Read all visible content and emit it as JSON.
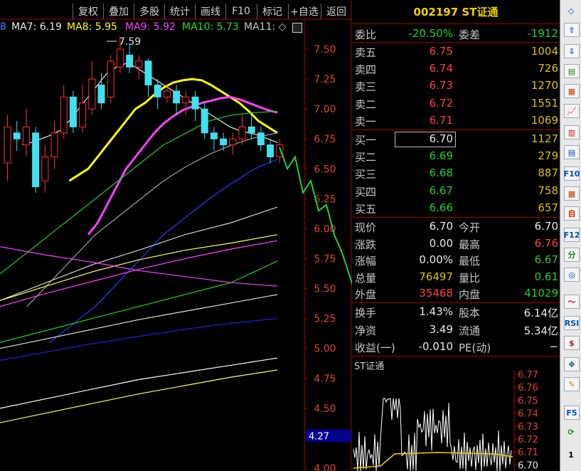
{
  "toolbar": {
    "items": [
      "复权",
      "叠加",
      "多股",
      "统计",
      "画线",
      "F10",
      "标记",
      "+自选",
      "返回"
    ]
  },
  "ma_legend": [
    {
      "label": "8",
      "color": "#4080ff"
    },
    {
      "label": "MA7: 6.19",
      "color": "#e8e8e8"
    },
    {
      "label": "MA8: 5.95",
      "color": "#ffff00"
    },
    {
      "label": "MA9: 5.92",
      "color": "#ff40ff"
    },
    {
      "label": "MA10: 5.73",
      "color": "#20e020"
    },
    {
      "label": "MA11: ◇",
      "color": "#c8c8c8"
    }
  ],
  "chart_data": {
    "type": "candlestick",
    "title": "",
    "y_ticks": [
      "7.50",
      "7.25",
      "7.00",
      "6.75",
      "6.50",
      "6.25",
      "6.00",
      "5.75",
      "5.50",
      "5.25",
      "5.00",
      "4.75",
      "4.50",
      "4.25",
      "4.00"
    ],
    "ylim": [
      4.0,
      7.59
    ],
    "high_annotation": "7.59",
    "cursor_price": "4.27",
    "candles": [
      {
        "o": 6.55,
        "c": 6.85,
        "h": 6.95,
        "l": 6.4
      },
      {
        "o": 6.8,
        "c": 6.75,
        "h": 6.9,
        "l": 6.65
      },
      {
        "o": 6.7,
        "c": 6.85,
        "h": 7.0,
        "l": 6.6
      },
      {
        "o": 6.8,
        "c": 6.35,
        "h": 6.85,
        "l": 6.3
      },
      {
        "o": 6.4,
        "c": 6.6,
        "h": 6.7,
        "l": 6.3
      },
      {
        "o": 6.6,
        "c": 6.8,
        "h": 6.9,
        "l": 6.5
      },
      {
        "o": 6.8,
        "c": 7.1,
        "h": 7.2,
        "l": 6.75
      },
      {
        "o": 7.1,
        "c": 6.85,
        "h": 7.15,
        "l": 6.8
      },
      {
        "o": 6.85,
        "c": 7.05,
        "h": 7.2,
        "l": 6.8
      },
      {
        "o": 7.0,
        "c": 7.25,
        "h": 7.4,
        "l": 6.95
      },
      {
        "o": 7.2,
        "c": 7.05,
        "h": 7.3,
        "l": 7.0
      },
      {
        "o": 7.1,
        "c": 7.4,
        "h": 7.45,
        "l": 7.05
      },
      {
        "o": 7.35,
        "c": 7.5,
        "h": 7.59,
        "l": 7.3
      },
      {
        "o": 7.45,
        "c": 7.35,
        "h": 7.55,
        "l": 7.3
      },
      {
        "o": 7.35,
        "c": 7.4,
        "h": 7.45,
        "l": 7.25
      },
      {
        "o": 7.4,
        "c": 7.2,
        "h": 7.42,
        "l": 7.1
      },
      {
        "o": 7.2,
        "c": 7.1,
        "h": 7.25,
        "l": 7.0
      },
      {
        "o": 7.1,
        "c": 7.15,
        "h": 7.2,
        "l": 7.05
      },
      {
        "o": 7.15,
        "c": 7.05,
        "h": 7.2,
        "l": 6.95
      },
      {
        "o": 7.05,
        "c": 7.1,
        "h": 7.15,
        "l": 6.95
      },
      {
        "o": 7.1,
        "c": 7.0,
        "h": 7.15,
        "l": 6.9
      },
      {
        "o": 7.0,
        "c": 6.8,
        "h": 7.05,
        "l": 6.75
      },
      {
        "o": 6.8,
        "c": 6.75,
        "h": 6.85,
        "l": 6.65
      },
      {
        "o": 6.75,
        "c": 6.7,
        "h": 6.8,
        "l": 6.65
      },
      {
        "o": 6.7,
        "c": 6.75,
        "h": 6.8,
        "l": 6.62
      },
      {
        "o": 6.75,
        "c": 6.85,
        "h": 6.95,
        "l": 6.7
      },
      {
        "o": 6.85,
        "c": 6.8,
        "h": 6.95,
        "l": 6.75
      },
      {
        "o": 6.8,
        "c": 6.7,
        "h": 6.85,
        "l": 6.65
      },
      {
        "o": 6.7,
        "c": 6.6,
        "h": 6.75,
        "l": 6.55
      },
      {
        "o": 6.6,
        "c": 6.7,
        "h": 6.75,
        "l": 6.55
      }
    ],
    "ma_lines": [
      {
        "color": "#e8e8e8",
        "values": [
          6.7,
          6.72,
          6.75,
          6.78,
          6.82,
          6.9,
          7.0,
          7.1,
          7.2,
          7.3,
          7.35,
          7.38,
          7.35,
          7.3,
          7.25,
          7.2,
          7.15,
          7.1,
          7.05,
          7.0,
          6.95,
          6.9,
          6.85,
          6.82,
          6.8,
          6.78,
          6.75,
          6.72
        ]
      },
      {
        "color": "#ffff00",
        "values": [
          6.4,
          6.45,
          6.5,
          6.6,
          6.7,
          6.8,
          6.9,
          7.0,
          7.05,
          7.12,
          7.18,
          7.22,
          7.24,
          7.25,
          7.24,
          7.2,
          7.15,
          7.1,
          7.05,
          6.98,
          6.9,
          6.85,
          6.8
        ]
      },
      {
        "color": "#ff40ff",
        "values": [
          5.95,
          6.05,
          6.2,
          6.35,
          6.5,
          6.6,
          6.7,
          6.8,
          6.88,
          6.94,
          6.99,
          7.02,
          7.05,
          7.07,
          7.09,
          7.1,
          7.08,
          7.05,
          7.02,
          6.99,
          6.97
        ]
      },
      {
        "color": "#20d020",
        "values": [
          5.2,
          5.35,
          5.5,
          5.65,
          5.8,
          5.95,
          6.1,
          6.25,
          6.4,
          6.55,
          6.7,
          6.8,
          6.9,
          6.95,
          6.97,
          6.98
        ]
      },
      {
        "color": "#a0a0a0",
        "values": [
          5.35,
          5.55,
          5.75,
          5.95,
          6.1,
          6.25,
          6.4,
          6.52,
          6.62,
          6.7,
          6.76,
          6.8
        ]
      },
      {
        "color": "#2040ff",
        "values": [
          5.05,
          5.2,
          5.35,
          5.55,
          5.75,
          5.95,
          6.1,
          6.25,
          6.38,
          6.5,
          6.58
        ]
      },
      {
        "color": "#d0d0d0",
        "values": [
          5.25,
          5.4,
          5.55,
          5.7,
          5.82,
          5.95,
          6.05,
          6.18
        ]
      },
      {
        "color": "#ffff40",
        "values": [
          5.4,
          5.52,
          5.64,
          5.74,
          5.82,
          5.88,
          5.95
        ]
      },
      {
        "color": "#ff40ff",
        "values": [
          5.35,
          5.46,
          5.56,
          5.66,
          5.75,
          5.83,
          5.9
        ]
      },
      {
        "color": "#20d020",
        "values": [
          5.05,
          5.15,
          5.25,
          5.35,
          5.45,
          5.55,
          5.73
        ]
      },
      {
        "color": "#ff40ff",
        "values": [
          5.85,
          5.78,
          5.72,
          5.65,
          5.6,
          5.55,
          5.52
        ]
      },
      {
        "color": "#e0e0e0",
        "values": [
          5.0,
          5.08,
          5.16,
          5.24,
          5.31,
          5.38,
          5.45
        ]
      },
      {
        "color": "#2020e0",
        "values": [
          4.9,
          4.97,
          5.04,
          5.1,
          5.16,
          5.21,
          5.25
        ]
      },
      {
        "color": "#ffffff",
        "values": [
          4.5,
          4.58,
          4.66,
          4.74,
          4.8,
          4.86,
          4.92
        ]
      },
      {
        "color": "#ffff40",
        "values": [
          4.38,
          4.46,
          4.54,
          4.62,
          4.69,
          4.76,
          4.82
        ]
      }
    ],
    "projection": [
      6.68,
      6.5,
      6.6,
      6.3,
      6.4,
      6.15,
      6.2,
      5.95,
      5.8,
      5.6,
      5.4
    ]
  },
  "quote": {
    "code": "002197",
    "name": "ST证通",
    "weibi_label": "委比",
    "weibi": "-20.50%",
    "weicha_label": "委差",
    "weicha": "-1912",
    "asks": [
      {
        "label": "卖五",
        "price": "6.75",
        "vol": "1004"
      },
      {
        "label": "卖四",
        "price": "6.74",
        "vol": "726"
      },
      {
        "label": "卖三",
        "price": "6.73",
        "vol": "1270"
      },
      {
        "label": "卖二",
        "price": "6.72",
        "vol": "1551"
      },
      {
        "label": "卖一",
        "price": "6.71",
        "vol": "1069"
      }
    ],
    "bids": [
      {
        "label": "买一",
        "price": "6.70",
        "vol": "1127"
      },
      {
        "label": "买二",
        "price": "6.69",
        "vol": "279"
      },
      {
        "label": "买三",
        "price": "6.68",
        "vol": "887"
      },
      {
        "label": "买四",
        "price": "6.67",
        "vol": "758"
      },
      {
        "label": "买五",
        "price": "6.66",
        "vol": "657"
      }
    ],
    "stats": [
      {
        "l1": "现价",
        "v1": "6.70",
        "c1": "wht",
        "l2": "今开",
        "v2": "6.70",
        "c2": "wht"
      },
      {
        "l1": "涨跌",
        "v1": "0.00",
        "c1": "wht",
        "l2": "最高",
        "v2": "6.76",
        "c2": "red"
      },
      {
        "l1": "涨幅",
        "v1": "0.00%",
        "c1": "wht",
        "l2": "最低",
        "v2": "6.67",
        "c2": "grn"
      },
      {
        "l1": "总量",
        "v1": "76497",
        "c1": "yel",
        "l2": "量比",
        "v2": "0.61",
        "c2": "grn"
      },
      {
        "l1": "外盘",
        "v1": "35468",
        "c1": "red",
        "l2": "内盘",
        "v2": "41029",
        "c2": "grn"
      }
    ],
    "stats2": [
      {
        "l1": "换手",
        "v1": "1.43%",
        "l2": "股本",
        "v2": "6.14亿"
      },
      {
        "l1": "净资",
        "v1": "3.49",
        "l2": "流通",
        "v2": "5.34亿"
      },
      {
        "l1": "收益(一)",
        "v1": "-0.010",
        "l2": "PE(动)",
        "v2": "−"
      }
    ],
    "mini_title": "ST证通",
    "mini_ticks": [
      "6.77",
      "6.76",
      "6.75",
      "6.74",
      "6.73",
      "6.72",
      "6.71",
      "6.70"
    ]
  },
  "sidebar": {
    "icons": [
      "◇",
      "⇧",
      "⇩",
      "▤",
      "▦",
      "📈",
      "▥",
      "▤",
      "F10",
      "▦",
      "自",
      "F12",
      "分",
      "◎",
      "〜",
      "RSI",
      "$",
      "✥",
      "✎",
      "F5",
      "⟳",
      "1"
    ]
  }
}
